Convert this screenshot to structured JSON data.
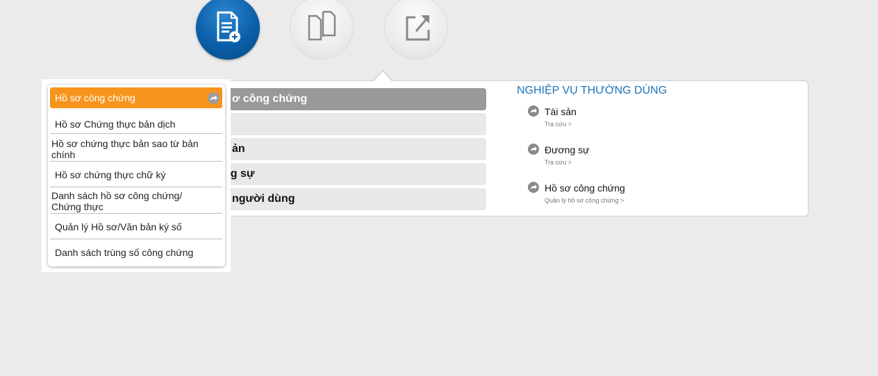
{
  "top_icons": [
    {
      "name": "new-document-icon",
      "state": "active"
    },
    {
      "name": "copy-document-icon",
      "state": "inactive"
    },
    {
      "name": "export-icon",
      "state": "inactive"
    }
  ],
  "main_menu": {
    "items": [
      "ơ công chứng",
      "",
      "ản",
      "ng sự",
      "người dùng"
    ]
  },
  "common_ops": {
    "title": "NGHIỆP VỤ THƯỜNG DÙNG",
    "items": [
      {
        "label": "Tài sản",
        "sub": "Tra cứu >"
      },
      {
        "label": "Đương sự",
        "sub": "Tra cứu >"
      },
      {
        "label": "Hồ sơ công chứng",
        "sub": "Quản lý hồ sơ công chứng >"
      }
    ]
  },
  "dropdown": {
    "items": [
      "Hồ sơ công chứng",
      "Hồ sơ Chứng thực bản dịch",
      " Hồ sơ chứng thực bản sao từ bản chính",
      "Hồ sơ chứng thực chữ ký",
      " Danh sách hồ sơ công chứng/ Chứng thực",
      "Quản lý Hồ sơ/Văn bản ký số",
      "Danh sách trùng số công chứng"
    ]
  },
  "colors": {
    "accent_orange": "#f7941d",
    "brand_blue": "#0a5fa8",
    "title_blue": "#1e73b7",
    "active_bar_gray": "#999999"
  }
}
